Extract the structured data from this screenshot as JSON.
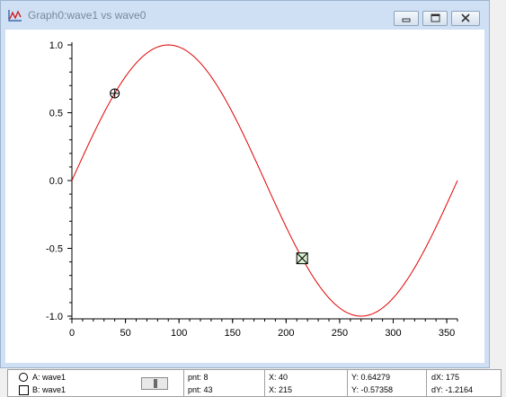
{
  "window": {
    "title": "Graph0:wave1 vs wave0"
  },
  "icons": {
    "app": "graph-icon",
    "minimize": "minimize-icon",
    "maximize": "maximize-icon",
    "close": "close-icon",
    "cursor_a": "crosshair-circle-icon",
    "cursor_b": "x-square-icon"
  },
  "chart_data": {
    "type": "line",
    "title": "",
    "xlabel": "",
    "ylabel": "",
    "xlim": [
      0,
      360
    ],
    "ylim": [
      -1.0,
      1.0
    ],
    "x_ticks": [
      0,
      50,
      100,
      150,
      200,
      250,
      300,
      350
    ],
    "y_ticks": [
      "1.0",
      "0.5",
      "0.0",
      "-0.5",
      "-1.0"
    ],
    "series": [
      {
        "color": "#e00000",
        "x": [
          0,
          10,
          20,
          30,
          40,
          50,
          60,
          70,
          80,
          90,
          100,
          110,
          120,
          130,
          140,
          150,
          160,
          170,
          180,
          190,
          200,
          210,
          220,
          230,
          240,
          250,
          260,
          270,
          280,
          290,
          300,
          310,
          320,
          330,
          340,
          350,
          360
        ],
        "y": [
          0,
          0.1736,
          0.342,
          0.5,
          0.6428,
          0.766,
          0.866,
          0.9397,
          0.9848,
          1,
          0.9848,
          0.9397,
          0.866,
          0.766,
          0.6428,
          0.5,
          0.342,
          0.1736,
          0,
          -0.1736,
          -0.342,
          -0.5,
          -0.6428,
          -0.766,
          -0.866,
          -0.9397,
          -0.9848,
          -1,
          -0.9848,
          -0.9397,
          -0.866,
          -0.766,
          -0.6428,
          -0.5,
          -0.342,
          -0.1736,
          0
        ]
      }
    ],
    "cursors": [
      {
        "id": "A",
        "x": 40,
        "y": 0.64279
      },
      {
        "id": "B",
        "x": 215,
        "y": -0.57358
      }
    ],
    "grid": false
  },
  "info": {
    "cursor_a": {
      "wave": "A: wave1",
      "pnt": "pnt: 8",
      "x": "X: 40",
      "y": "Y: 0.64279"
    },
    "cursor_b": {
      "wave": "B: wave1",
      "pnt": "pnt: 43",
      "x": "X: 215",
      "y": "Y: -0.57358"
    },
    "dx": "dX: 175",
    "dy": "dY: -1.2164"
  }
}
